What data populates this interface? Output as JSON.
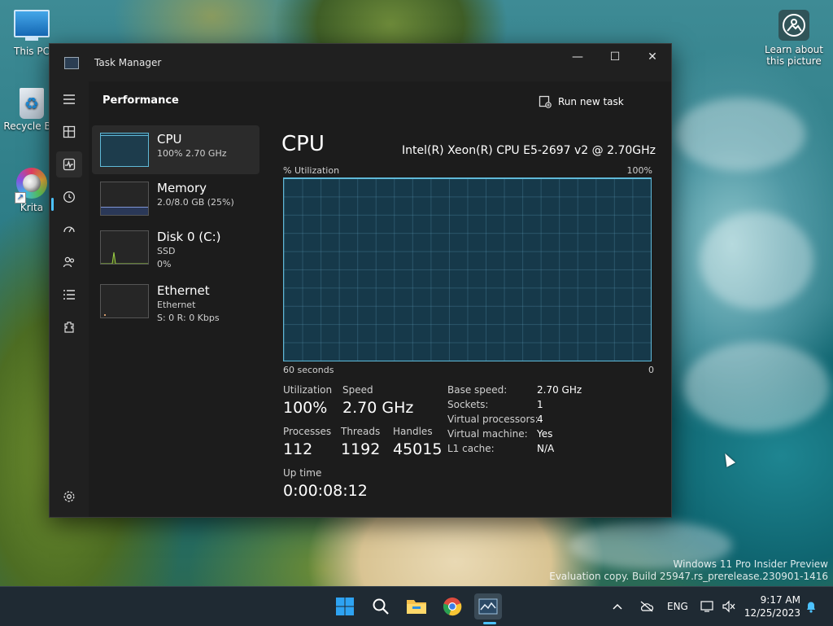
{
  "desktop": {
    "icons": [
      {
        "label": "This PC"
      },
      {
        "label": "Recycle Bin"
      },
      {
        "label": "Krita"
      }
    ],
    "learn_label": "Learn about this picture",
    "watermark_line1": "Windows 11 Pro Insider Preview",
    "watermark_line2": "Evaluation copy. Build 25947.rs_prerelease.230901-1416"
  },
  "window": {
    "title": "Task Manager",
    "minimize_glyph": "—",
    "maximize_glyph": "☐",
    "close_glyph": "✕"
  },
  "nav": {
    "items": [
      "hamburger-menu-icon",
      "processes-icon",
      "performance-icon",
      "app-history-icon",
      "startup-apps-icon",
      "users-icon",
      "details-icon",
      "services-icon"
    ],
    "settings": "settings-icon",
    "active": "performance-icon"
  },
  "header": {
    "title": "Performance",
    "run_new_task": "Run new task",
    "more": "•••"
  },
  "perf_list": [
    {
      "name": "CPU",
      "lines": [
        "100%  2.70 GHz"
      ]
    },
    {
      "name": "Memory",
      "lines": [
        "2.0/8.0 GB (25%)"
      ]
    },
    {
      "name": "Disk 0 (C:)",
      "lines": [
        "SSD",
        "0%"
      ]
    },
    {
      "name": "Ethernet",
      "lines": [
        "Ethernet",
        "S: 0  R: 0 Kbps"
      ]
    }
  ],
  "cpu": {
    "title": "CPU",
    "model": "Intel(R) Xeon(R) CPU E5-2697 v2 @ 2.70GHz",
    "graph_label_left": "% Utilization",
    "graph_label_right": "100%",
    "graph_bottom_left": "60 seconds",
    "graph_bottom_right": "0",
    "utilization_label": "Utilization",
    "utilization_value": "100%",
    "speed_label": "Speed",
    "speed_value": "2.70 GHz",
    "processes_label": "Processes",
    "processes_value": "112",
    "threads_label": "Threads",
    "threads_value": "1192",
    "handles_label": "Handles",
    "handles_value": "45015",
    "uptime_label": "Up time",
    "uptime_value": "0:00:08:12",
    "details": [
      {
        "label": "Base speed:",
        "value": "2.70 GHz"
      },
      {
        "label": "Sockets:",
        "value": "1"
      },
      {
        "label": "Virtual processors:",
        "value": "4"
      },
      {
        "label": "Virtual machine:",
        "value": "Yes"
      },
      {
        "label": "L1 cache:",
        "value": "N/A"
      }
    ]
  },
  "taskbar": {
    "apps": [
      "start-icon",
      "search-icon",
      "file-explorer-icon",
      "chrome-icon",
      "task-manager-icon"
    ],
    "language": "ENG",
    "time": "9:17 AM",
    "date": "12/25/2023",
    "accent": "#4cc2ff"
  }
}
